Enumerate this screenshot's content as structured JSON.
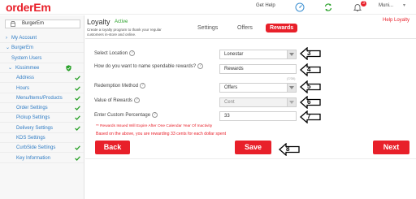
{
  "app": {
    "logo": "orderEm",
    "brand_color": "#e8202a"
  },
  "topbar": {
    "get_help": "Get Help",
    "notification_count": "3",
    "user_name": "Muni...",
    "icons": [
      "speedometer-icon",
      "refresh-icon",
      "notification-bell-icon",
      "user-avatar-icon",
      "chevron-down-icon"
    ]
  },
  "sidebar": {
    "store_select": "BurgerEm",
    "items": [
      {
        "label": "My Account",
        "chevron": "›",
        "indent": "top"
      },
      {
        "label": "BurgerEm",
        "chevron": "⌄",
        "indent": "top"
      },
      {
        "label": "System Users",
        "indent": "level1"
      },
      {
        "label": "Kissimmee",
        "chevron": "⌄",
        "indent": "level1b",
        "shield": true
      },
      {
        "label": "Address",
        "indent": "level2",
        "checked": true
      },
      {
        "label": "Hours",
        "indent": "level2",
        "checked": true
      },
      {
        "label": "Menu/Items/Products",
        "indent": "level2",
        "checked": true
      },
      {
        "label": "Order Settings",
        "indent": "level2",
        "checked": true
      },
      {
        "label": "Pickup Settings",
        "indent": "level2",
        "checked": true
      },
      {
        "label": "Delivery Settings",
        "indent": "level2",
        "checked": true
      },
      {
        "label": "KDS Settings",
        "indent": "level2"
      },
      {
        "label": "CurbSide Settings",
        "indent": "level2",
        "checked": true
      },
      {
        "label": "Key Information",
        "indent": "level2",
        "checked": true
      }
    ]
  },
  "header": {
    "title": "Loyalty",
    "status": "Active",
    "description": "Create a loyalty program to thank your regular customers in-store and online.",
    "tabs": [
      {
        "label": "Settings",
        "active": false
      },
      {
        "label": "Offers",
        "active": false
      },
      {
        "label": "Rewards",
        "active": true
      }
    ],
    "help_link": "Help Loyalty"
  },
  "form": {
    "select_location": {
      "label": "Select Location",
      "value": "Lonestar"
    },
    "spendable_name": {
      "label": "How do you want to name spendable rewards?",
      "value": "Rewards",
      "counter": "(7/30)"
    },
    "redemption_method": {
      "label": "Redemption Method",
      "value": "Offers"
    },
    "value_of_rewards": {
      "label": "Value of Rewards",
      "value": "Cent"
    },
    "custom_percentage": {
      "label": "Enter Custom Percentage",
      "value": "33"
    },
    "help_glyph": "?",
    "warning": "** Rewards Issued Will Expire After One Calendar Year Of Inactivity",
    "info": "Based on the above, you are rewarding 33 cents for each dollar spent"
  },
  "callouts": [
    "3",
    "4",
    "5",
    "6",
    "7",
    "8"
  ],
  "buttons": {
    "back": "Back",
    "save": "Save",
    "next": "Next"
  }
}
